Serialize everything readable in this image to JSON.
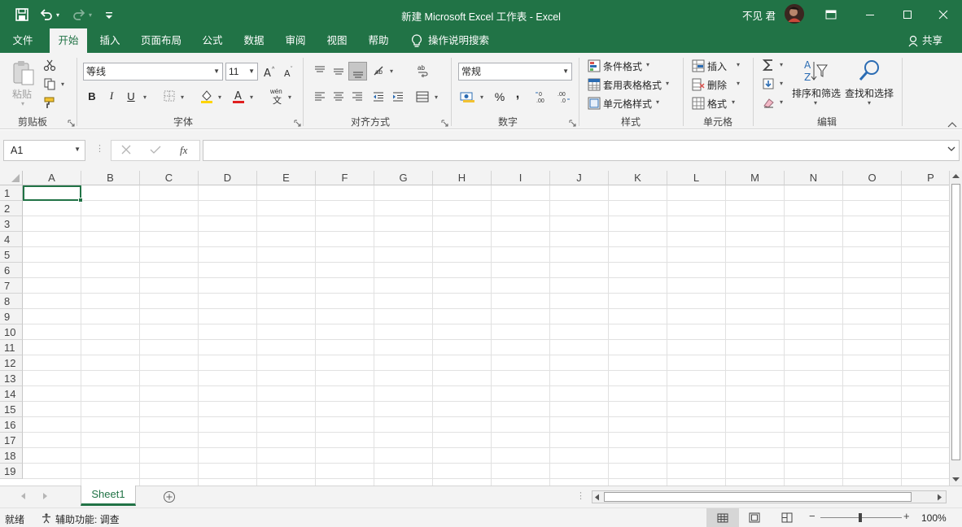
{
  "window": {
    "title": "新建 Microsoft Excel 工作表  -  Excel",
    "user_name": "不见 君",
    "accent_color": "#217346"
  },
  "tabs": [
    "文件",
    "开始",
    "插入",
    "页面布局",
    "公式",
    "数据",
    "审阅",
    "视图",
    "帮助"
  ],
  "tell_me": "操作说明搜索",
  "share_label": "共享",
  "ribbon": {
    "clipboard": {
      "paste": "粘贴",
      "label": "剪贴板"
    },
    "font": {
      "name": "等线",
      "size": "11",
      "bold": "B",
      "italic": "I",
      "underline": "U",
      "label": "字体"
    },
    "alignment": {
      "label": "对齐方式"
    },
    "number": {
      "format": "常规",
      "percent": "%",
      "comma": ",",
      "label": "数字"
    },
    "styles": {
      "conditional": "条件格式",
      "table": "套用表格格式",
      "cell": "单元格样式",
      "label": "样式"
    },
    "cells": {
      "insert": "插入",
      "delete": "删除",
      "format": "格式",
      "label": "单元格"
    },
    "editing": {
      "sort": "排序和筛选",
      "find": "查找和选择",
      "label": "编辑"
    }
  },
  "formula_bar": {
    "name_box": "A1",
    "fx": "fx",
    "formula": ""
  },
  "grid": {
    "columns": [
      "A",
      "B",
      "C",
      "D",
      "E",
      "F",
      "G",
      "H",
      "I",
      "J",
      "K",
      "L",
      "M",
      "N",
      "O",
      "P"
    ],
    "rows": [
      "1",
      "2",
      "3",
      "4",
      "5",
      "6",
      "7",
      "8",
      "9",
      "10",
      "11",
      "12",
      "13",
      "14",
      "15",
      "16",
      "17",
      "18",
      "19"
    ]
  },
  "sheets": [
    "Sheet1"
  ],
  "status": {
    "ready": "就绪",
    "accessibility": "辅助功能: 调查",
    "zoom": "100%"
  }
}
